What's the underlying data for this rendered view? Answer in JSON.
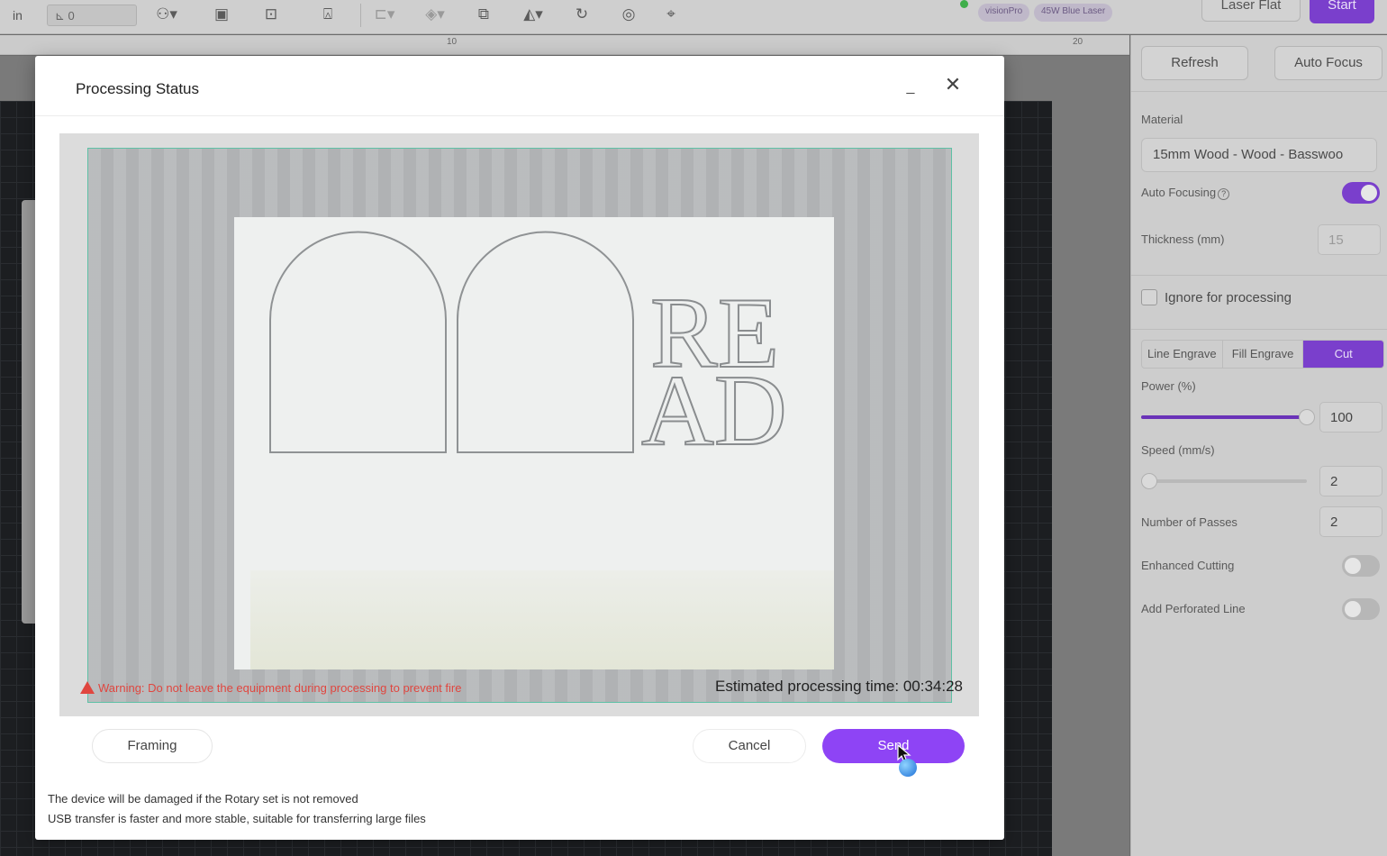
{
  "toolbar": {
    "unit": "in",
    "field_value": "⊾ 0",
    "machine_chip": "visionPro",
    "laser_chip": "45W Blue Laser",
    "laser_mode_label": "Laser Flat",
    "start_label": "Start",
    "icons": [
      "shapes-icon",
      "select-icon",
      "trace-icon",
      "stamp-icon",
      "align-icon",
      "arrange-icon",
      "duplicate-icon",
      "flip-icon",
      "rotate-icon",
      "palette-icon",
      "focus-frame-icon"
    ]
  },
  "ruler": {
    "ticks": [
      "10",
      "20"
    ]
  },
  "panel": {
    "refresh_label": "Refresh",
    "auto_focus_label": "Auto Focus",
    "material_label": "Material",
    "material_value": "15mm Wood - Wood - Basswoo",
    "auto_focusing_label": "Auto Focusing",
    "auto_focusing_on": true,
    "thickness_label": "Thickness (mm)",
    "thickness_value": "15",
    "ignore_label": "Ignore for processing",
    "modes": [
      "Line Engrave",
      "Fill Engrave",
      "Cut"
    ],
    "active_mode": "Cut",
    "power_label": "Power (%)",
    "power_value": "100",
    "speed_label": "Speed (mm/s)",
    "speed_value": "2",
    "passes_label": "Number of Passes",
    "passes_value": "2",
    "enhanced_label": "Enhanced Cutting",
    "enhanced_on": false,
    "perforated_label": "Add Perforated Line",
    "perforated_on": false
  },
  "modal": {
    "title": "Processing Status",
    "minimize_glyph": "_",
    "close_glyph": "✕",
    "warning": "Warning: Do not leave the equipment during processing to prevent fire",
    "estimate": "Estimated processing time: 00:34:28",
    "framing_label": "Framing",
    "cancel_label": "Cancel",
    "send_label": "Send",
    "notes": [
      "The device will be damaged if the Rotary set is not removed",
      "USB transfer is faster and more stable, suitable for transferring large files"
    ],
    "design_text": [
      "RE",
      "AD"
    ]
  },
  "colors": {
    "accent": "#8e44f5",
    "warning": "#e0463f",
    "frame": "#5fc1a6"
  }
}
